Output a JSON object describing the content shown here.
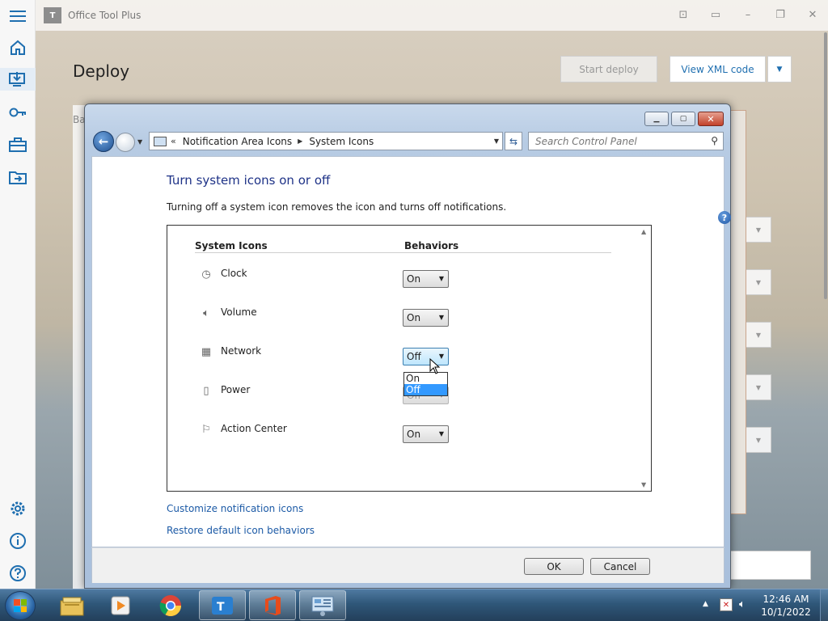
{
  "app": {
    "title": "Office Tool Plus",
    "logo_text": "T",
    "page_title": "Deploy",
    "start_deploy_label": "Start deploy",
    "view_xml_label": "View XML code",
    "partial_tab_label": "Ba",
    "nav_icons": [
      "menu-icon",
      "home-icon",
      "deploy-icon",
      "key-icon",
      "toolbox-icon",
      "convert-icon",
      "settings-icon",
      "info-icon",
      "help-icon"
    ]
  },
  "dialog": {
    "address": {
      "overflow": "«",
      "crumbs": [
        "Notification Area Icons",
        "System Icons"
      ]
    },
    "search_placeholder": "Search Control Panel",
    "heading": "Turn system icons on or off",
    "description": "Turning off a system icon removes the icon and turns off notifications.",
    "columns": {
      "icons": "System Icons",
      "behaviors": "Behaviors"
    },
    "rows": [
      {
        "label": "Clock",
        "value": "On",
        "icon": "clock-icon"
      },
      {
        "label": "Volume",
        "value": "On",
        "icon": "volume-icon"
      },
      {
        "label": "Network",
        "value": "Off",
        "icon": "network-icon"
      },
      {
        "label": "Power",
        "value": "Off",
        "icon": "power-icon"
      },
      {
        "label": "Action Center",
        "value": "On",
        "icon": "action-center-icon"
      }
    ],
    "open_dropdown_options": [
      "On",
      "Off"
    ],
    "open_dropdown_highlighted": "Off",
    "link_customize": "Customize notification icons",
    "link_restore": "Restore default icon behaviors",
    "ok_label": "OK",
    "cancel_label": "Cancel"
  },
  "taskbar": {
    "pinned": [
      "windows-explorer-icon",
      "media-player-icon",
      "chrome-icon",
      "office-tool-plus-icon",
      "office-icon",
      "control-panel-icon"
    ],
    "clock_time": "12:46 AM",
    "clock_date": "10/1/2022"
  }
}
